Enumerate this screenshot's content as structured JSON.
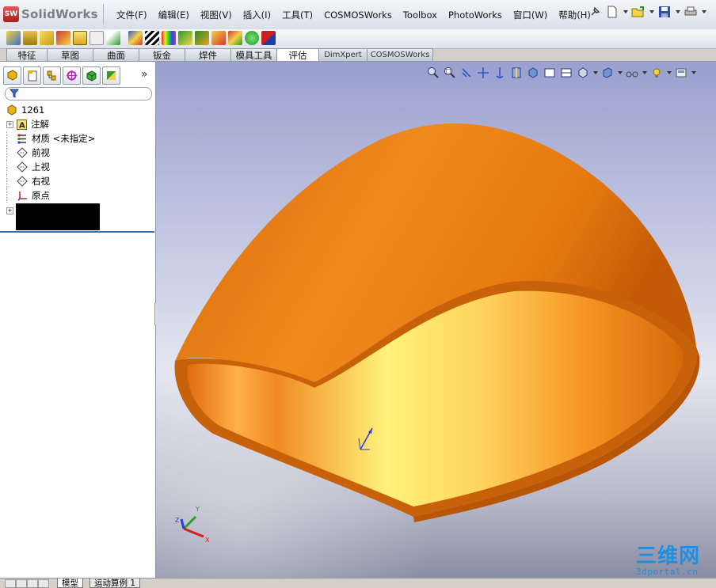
{
  "app": {
    "brand": "SolidWorks",
    "menu": [
      "文件(F)",
      "编辑(E)",
      "视图(V)",
      "插入(I)",
      "工具(T)",
      "COSMOSWorks",
      "Toolbox",
      "PhotoWorks",
      "窗口(W)",
      "帮助(H)"
    ]
  },
  "tabs": [
    {
      "label": "特征",
      "w": 50
    },
    {
      "label": "草图",
      "w": 57
    },
    {
      "label": "曲面",
      "w": 57
    },
    {
      "label": "钣金",
      "w": 57
    },
    {
      "label": "焊件",
      "w": 57
    },
    {
      "label": "模具工具",
      "w": 57
    },
    {
      "label": "评估",
      "w": 52,
      "active": true
    },
    {
      "label": "DimXpert",
      "w": 60,
      "small": true
    },
    {
      "label": "COSMOSWorks",
      "w": 82,
      "small": true
    }
  ],
  "tree": {
    "root": "1261",
    "items": [
      {
        "label": "注解",
        "icon": "annotation-icon",
        "expand": true
      },
      {
        "label": "材质 <未指定>",
        "icon": "material-icon",
        "expand": false
      },
      {
        "label": "前视",
        "icon": "plane-icon",
        "expand": false
      },
      {
        "label": "上视",
        "icon": "plane-icon",
        "expand": false
      },
      {
        "label": "右视",
        "icon": "plane-icon",
        "expand": false
      },
      {
        "label": "原点",
        "icon": "origin-icon",
        "expand": false
      }
    ]
  },
  "bottom_tabs": [
    "模型",
    "运动算例 1"
  ],
  "watermark": {
    "cn": "三维网",
    "url": "3dportal.cn"
  },
  "colors": {
    "part_orange": "#e8760f",
    "part_highlight": "#fff27a",
    "brand_red": "#c42b2b",
    "watermark_blue": "#1e8fe0"
  }
}
